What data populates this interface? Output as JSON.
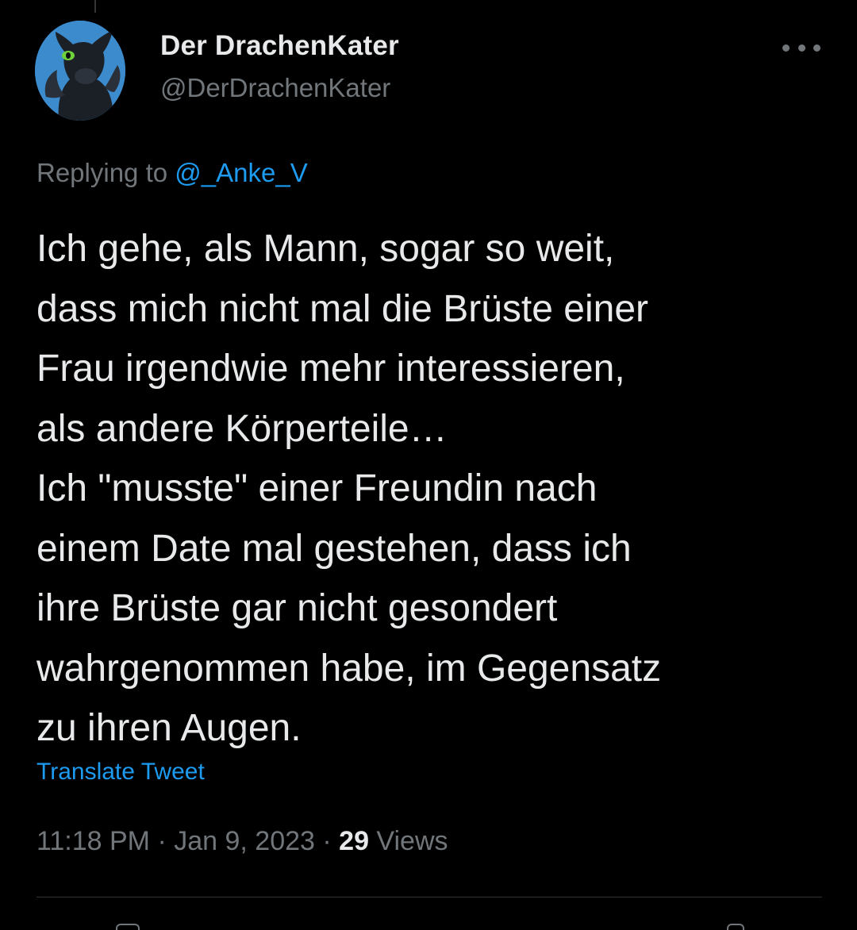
{
  "colors": {
    "background": "#000000",
    "text_primary": "#e7e9ea",
    "text_secondary": "#71767b",
    "link": "#1d9bf0",
    "divider": "#2f3336",
    "avatar_bg": "#3b8bcd"
  },
  "author": {
    "display_name": "Der DrachenKater",
    "handle": "@DerDrachenKater",
    "avatar_icon": "dragon-avatar-icon"
  },
  "more_icon": "more-horizontal-icon",
  "reply": {
    "prefix": "Replying to ",
    "mention": "@_Anke_V"
  },
  "tweet": {
    "lines": [
      "Ich gehe, als Mann, sogar so weit,",
      "dass mich nicht mal die Brüste einer",
      "Frau irgendwie mehr interessieren,",
      "als andere Körperteile…",
      "Ich \"musste\" einer Freundin nach",
      "einem Date mal gestehen, dass ich",
      "ihre Brüste gar nicht gesondert",
      "wahrgenommen habe, im Gegensatz",
      "zu ihren Augen."
    ]
  },
  "translate_label": "Translate Tweet",
  "meta": {
    "time": "11:18 PM",
    "separator": " · ",
    "date": "Jan 9, 2023",
    "views_count": "29",
    "views_label": " Views"
  }
}
